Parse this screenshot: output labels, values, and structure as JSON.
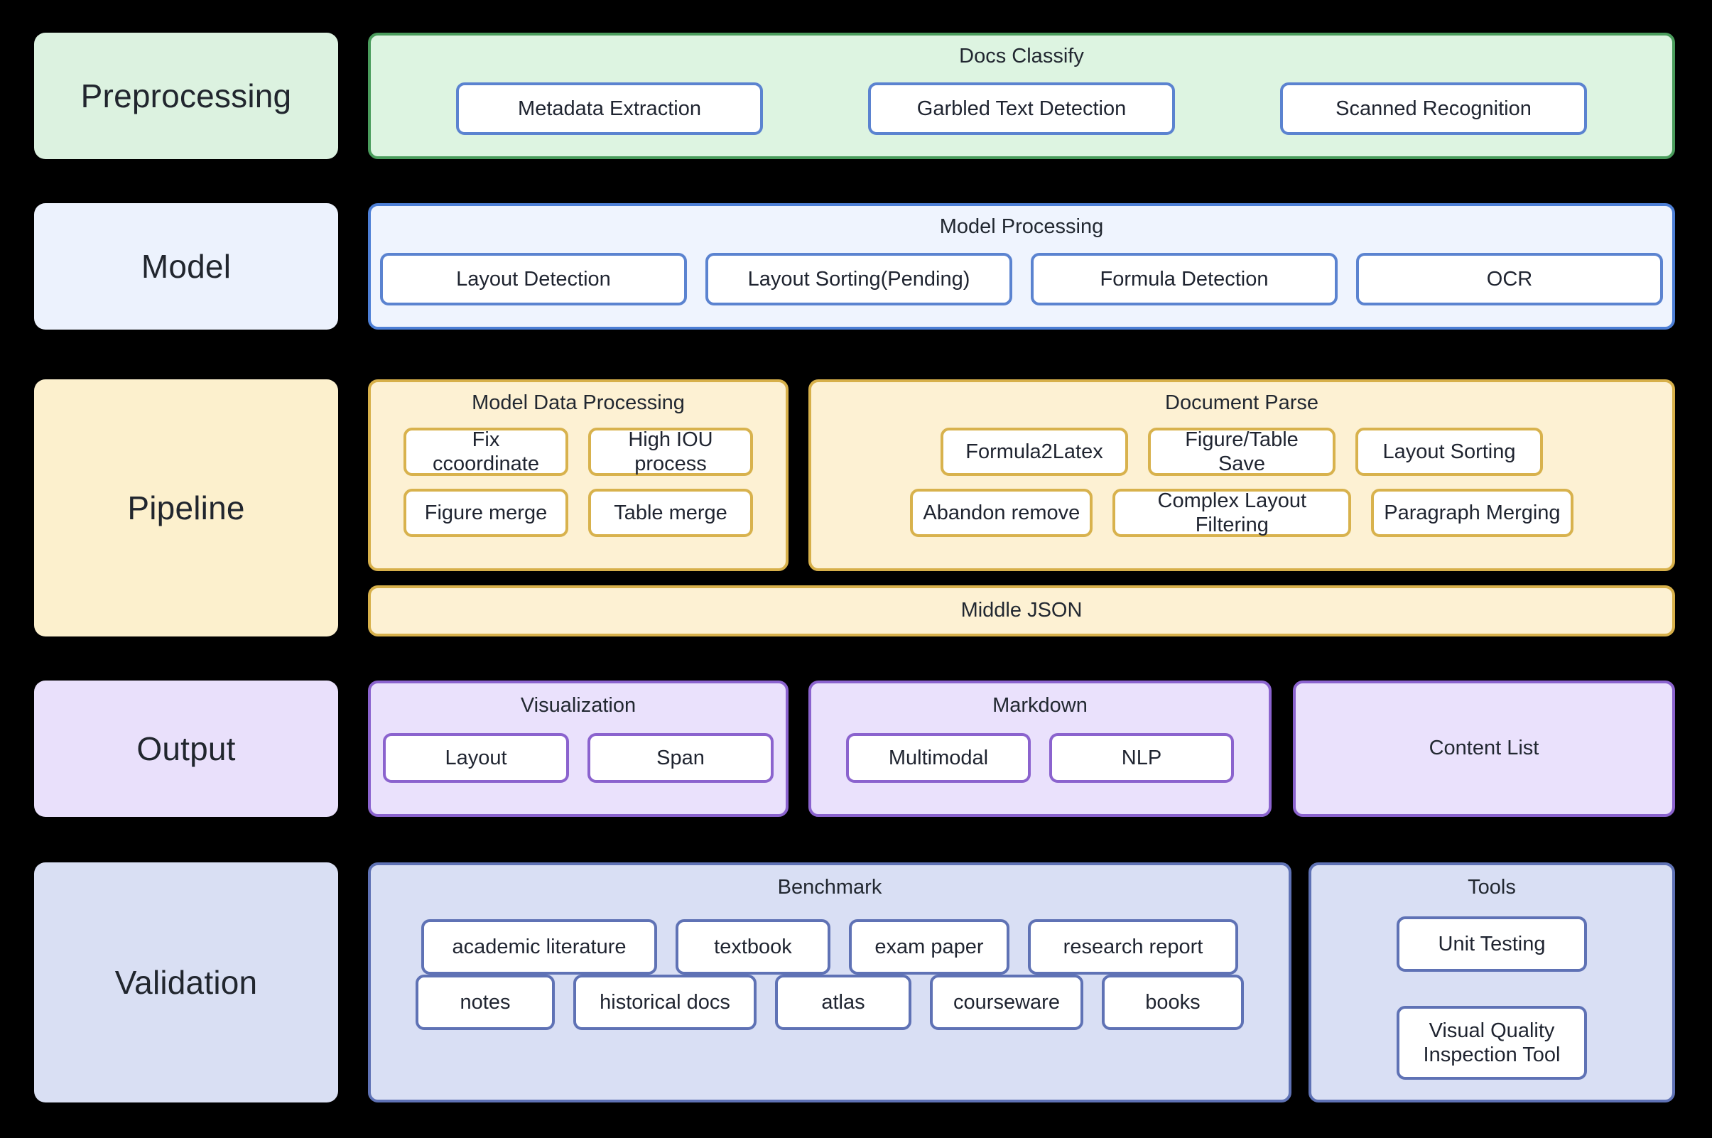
{
  "diagram": {
    "title": "Document parsing pipeline architecture",
    "background": "#000000",
    "palette": {
      "green_fill": "#ddf4e1",
      "green_border": "#4a9c5c",
      "blue_fill": "#eff4fe",
      "blue_border": "#4d7fd6",
      "yellow_fill": "#fdf1d3",
      "yellow_border": "#d7b04a",
      "violet_fill": "#eae1fc",
      "violet_border": "#8b63ce",
      "periwinkle_fill": "#d9dff4",
      "periwinkle_border": "#5f72b5",
      "chip_fill": "#ffffff",
      "text": "#1f2430"
    }
  },
  "stages": {
    "preprocessing": {
      "label": "Preprocessing",
      "groups": {
        "docs_classify": {
          "title": "Docs Classify",
          "items": [
            "Metadata Extraction",
            "Garbled Text Detection",
            "Scanned Recognition"
          ]
        }
      }
    },
    "model": {
      "label": "Model",
      "groups": {
        "model_processing": {
          "title": "Model Processing",
          "items": [
            "Layout Detection",
            "Layout Sorting(Pending)",
            "Formula Detection",
            "OCR"
          ]
        }
      }
    },
    "pipeline": {
      "label": "Pipeline",
      "groups": {
        "model_data_processing": {
          "title": "Model Data Processing",
          "row1": [
            "Fix ccoordinate",
            "High IOU process"
          ],
          "row2": [
            "Figure merge",
            "Table merge"
          ]
        },
        "document_parse": {
          "title": "Document Parse",
          "row1": [
            "Formula2Latex",
            "Figure/Table Save",
            "Layout Sorting"
          ],
          "row2": [
            "Abandon remove",
            "Complex Layout Filtering",
            "Paragraph Merging"
          ]
        },
        "middle_json": {
          "title": "Middle JSON"
        }
      }
    },
    "output": {
      "label": "Output",
      "groups": {
        "visualization": {
          "title": "Visualization",
          "items": [
            "Layout",
            "Span"
          ]
        },
        "markdown": {
          "title": "Markdown",
          "items": [
            "Multimodal",
            "NLP"
          ]
        },
        "content_list": {
          "title": "Content List"
        }
      }
    },
    "validation": {
      "label": "Validation",
      "groups": {
        "benchmark": {
          "title": "Benchmark",
          "row1": [
            "academic literature",
            "textbook",
            "exam paper",
            "research report"
          ],
          "row2": [
            "notes",
            "historical docs",
            "atlas",
            "courseware",
            "books"
          ]
        },
        "tools": {
          "title": "Tools",
          "items": [
            "Unit Testing",
            "Visual Quality Inspection Tool"
          ]
        }
      }
    }
  }
}
